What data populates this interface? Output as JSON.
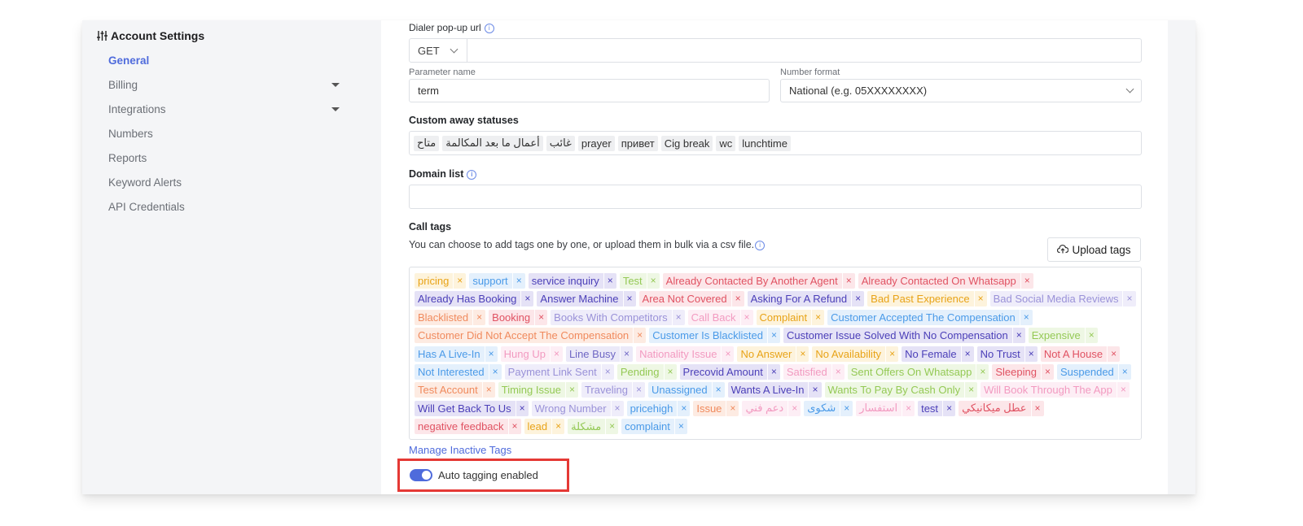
{
  "sidebar": {
    "title": "Account Settings",
    "items": [
      {
        "label": "General",
        "active": true,
        "caret": false
      },
      {
        "label": "Billing",
        "active": false,
        "caret": true
      },
      {
        "label": "Integrations",
        "active": false,
        "caret": true
      },
      {
        "label": "Numbers",
        "active": false,
        "caret": false
      },
      {
        "label": "Reports",
        "active": false,
        "caret": false
      },
      {
        "label": "Keyword Alerts",
        "active": false,
        "caret": false
      },
      {
        "label": "API Credentials",
        "active": false,
        "caret": false
      }
    ]
  },
  "dialer": {
    "label": "Dialer pop-up url",
    "method": "GET",
    "url_value": "",
    "param_label": "Parameter name",
    "param_value": "term",
    "format_label": "Number format",
    "format_value": "National (e.g. 05XXXXXXXX)"
  },
  "away": {
    "label": "Custom away statuses",
    "statuses": [
      "متاح",
      "أعمال ما بعد المكالمة",
      "غائب",
      "prayer",
      "привет",
      "Cig break",
      "wc",
      "lunchtime"
    ]
  },
  "domain": {
    "label": "Domain list",
    "value": ""
  },
  "call_tags": {
    "label": "Call tags",
    "description": "You can choose to add tags one by one, or upload them in bulk via a csv file.",
    "upload_label": "Upload tags",
    "manage_link": "Manage Inactive Tags",
    "tags": [
      {
        "label": "pricing",
        "color": "#e8a317",
        "bg": "#fdf3dc"
      },
      {
        "label": "support",
        "color": "#4a9ae8",
        "bg": "#e4f0fc"
      },
      {
        "label": "service inquiry",
        "color": "#4b3fb8",
        "bg": "#e5e2f6"
      },
      {
        "label": "Test",
        "color": "#94c955",
        "bg": "#eef7e4"
      },
      {
        "label": "Already Contacted By Another Agent",
        "color": "#e05262",
        "bg": "#fce6e9"
      },
      {
        "label": "Already Contacted On Whatsapp",
        "color": "#e05262",
        "bg": "#fce6e9"
      },
      {
        "label": "Already Has Booking",
        "color": "#4b3fb8",
        "bg": "#e5e2f6"
      },
      {
        "label": "Answer Machine",
        "color": "#4b3fb8",
        "bg": "#e5e2f6"
      },
      {
        "label": "Area Not Covered",
        "color": "#e05262",
        "bg": "#fce6e9"
      },
      {
        "label": "Asking For A Refund",
        "color": "#4b3fb8",
        "bg": "#e5e2f6"
      },
      {
        "label": "Bad Past Experience",
        "color": "#e8a317",
        "bg": "#fdf3dc"
      },
      {
        "label": "Bad Social Media Reviews",
        "color": "#9a92d8",
        "bg": "#efedfa"
      },
      {
        "label": "Blacklisted",
        "color": "#f08a5d",
        "bg": "#fdebe2"
      },
      {
        "label": "Booking",
        "color": "#e05262",
        "bg": "#fce6e9"
      },
      {
        "label": "Books With Competitors",
        "color": "#9a92d8",
        "bg": "#efedfa"
      },
      {
        "label": "Call Back",
        "color": "#f29ac0",
        "bg": "#fdeef5"
      },
      {
        "label": "Complaint",
        "color": "#e8a317",
        "bg": "#fdf3dc"
      },
      {
        "label": "Customer Accepted The Compensation",
        "color": "#4a9ae8",
        "bg": "#e4f0fc"
      },
      {
        "label": "Customer Did Not Accept The Compensation",
        "color": "#f08a5d",
        "bg": "#fdebe2"
      },
      {
        "label": "Customer Is Blacklisted",
        "color": "#4a9ae8",
        "bg": "#e4f0fc"
      },
      {
        "label": "Customer Issue Solved With No Compensation",
        "color": "#4b3fb8",
        "bg": "#e5e2f6"
      },
      {
        "label": "Expensive",
        "color": "#94c955",
        "bg": "#eef7e4"
      },
      {
        "label": "Has A Live-In",
        "color": "#4a9ae8",
        "bg": "#e4f0fc"
      },
      {
        "label": "Hung Up",
        "color": "#f29ac0",
        "bg": "#fdeef5"
      },
      {
        "label": "Line Busy",
        "color": "#6f67c4",
        "bg": "#ebe9f8"
      },
      {
        "label": "Nationality Issue",
        "color": "#f29ac0",
        "bg": "#fdeef5"
      },
      {
        "label": "No Answer",
        "color": "#e8a317",
        "bg": "#fdf3dc"
      },
      {
        "label": "No Availability",
        "color": "#e8a317",
        "bg": "#fdf3dc"
      },
      {
        "label": "No Female",
        "color": "#4b3fb8",
        "bg": "#e5e2f6"
      },
      {
        "label": "No Trust",
        "color": "#4b3fb8",
        "bg": "#e5e2f6"
      },
      {
        "label": "Not A House",
        "color": "#e05262",
        "bg": "#fce6e9"
      },
      {
        "label": "Not Interested",
        "color": "#4a9ae8",
        "bg": "#e4f0fc"
      },
      {
        "label": "Payment Link Sent",
        "color": "#9a92d8",
        "bg": "#efedfa"
      },
      {
        "label": "Pending",
        "color": "#94c955",
        "bg": "#eef7e4"
      },
      {
        "label": "Precovid Amount",
        "color": "#4b3fb8",
        "bg": "#e5e2f6"
      },
      {
        "label": "Satisfied",
        "color": "#f29ac0",
        "bg": "#fdeef5"
      },
      {
        "label": "Sent Offers On Whatsapp",
        "color": "#94c955",
        "bg": "#eef7e4"
      },
      {
        "label": "Sleeping",
        "color": "#e05262",
        "bg": "#fce6e9"
      },
      {
        "label": "Suspended",
        "color": "#4a9ae8",
        "bg": "#e4f0fc"
      },
      {
        "label": "Test Account",
        "color": "#f08a5d",
        "bg": "#fdebe2"
      },
      {
        "label": "Timing Issue",
        "color": "#94c955",
        "bg": "#eef7e4"
      },
      {
        "label": "Traveling",
        "color": "#9a92d8",
        "bg": "#efedfa"
      },
      {
        "label": "Unassigned",
        "color": "#4a9ae8",
        "bg": "#e4f0fc"
      },
      {
        "label": "Wants A Live-In",
        "color": "#4b3fb8",
        "bg": "#e5e2f6"
      },
      {
        "label": "Wants To Pay By Cash Only",
        "color": "#94c955",
        "bg": "#eef7e4"
      },
      {
        "label": "Will Book Through The App",
        "color": "#f29ac0",
        "bg": "#fdeef5"
      },
      {
        "label": "Will Get Back To Us",
        "color": "#4b3fb8",
        "bg": "#e5e2f6"
      },
      {
        "label": "Wrong Number",
        "color": "#9a92d8",
        "bg": "#efedfa"
      },
      {
        "label": "pricehigh",
        "color": "#4a9ae8",
        "bg": "#e4f0fc"
      },
      {
        "label": "Issue",
        "color": "#f08a5d",
        "bg": "#fdebe2"
      },
      {
        "label": "دعم فني",
        "color": "#f29ac0",
        "bg": "#fdeef5"
      },
      {
        "label": "شكوى",
        "color": "#4a9ae8",
        "bg": "#e4f0fc"
      },
      {
        "label": "استفسار",
        "color": "#f29ac0",
        "bg": "#fdeef5"
      },
      {
        "label": "test",
        "color": "#4b3fb8",
        "bg": "#e5e2f6"
      },
      {
        "label": "عطل ميكانيكي",
        "color": "#e05262",
        "bg": "#fce6e9"
      },
      {
        "label": "negative feedback",
        "color": "#e05262",
        "bg": "#fce6e9"
      },
      {
        "label": "lead",
        "color": "#e8a317",
        "bg": "#fdf3dc"
      },
      {
        "label": "مشكلة",
        "color": "#94c955",
        "bg": "#eef7e4"
      },
      {
        "label": "complaint",
        "color": "#4a9ae8",
        "bg": "#e4f0fc"
      }
    ]
  },
  "auto_tagging": {
    "label": "Auto tagging enabled",
    "enabled": true,
    "highlight_color": "#e53935"
  },
  "colors": {
    "accent": "#4f6bdc"
  }
}
